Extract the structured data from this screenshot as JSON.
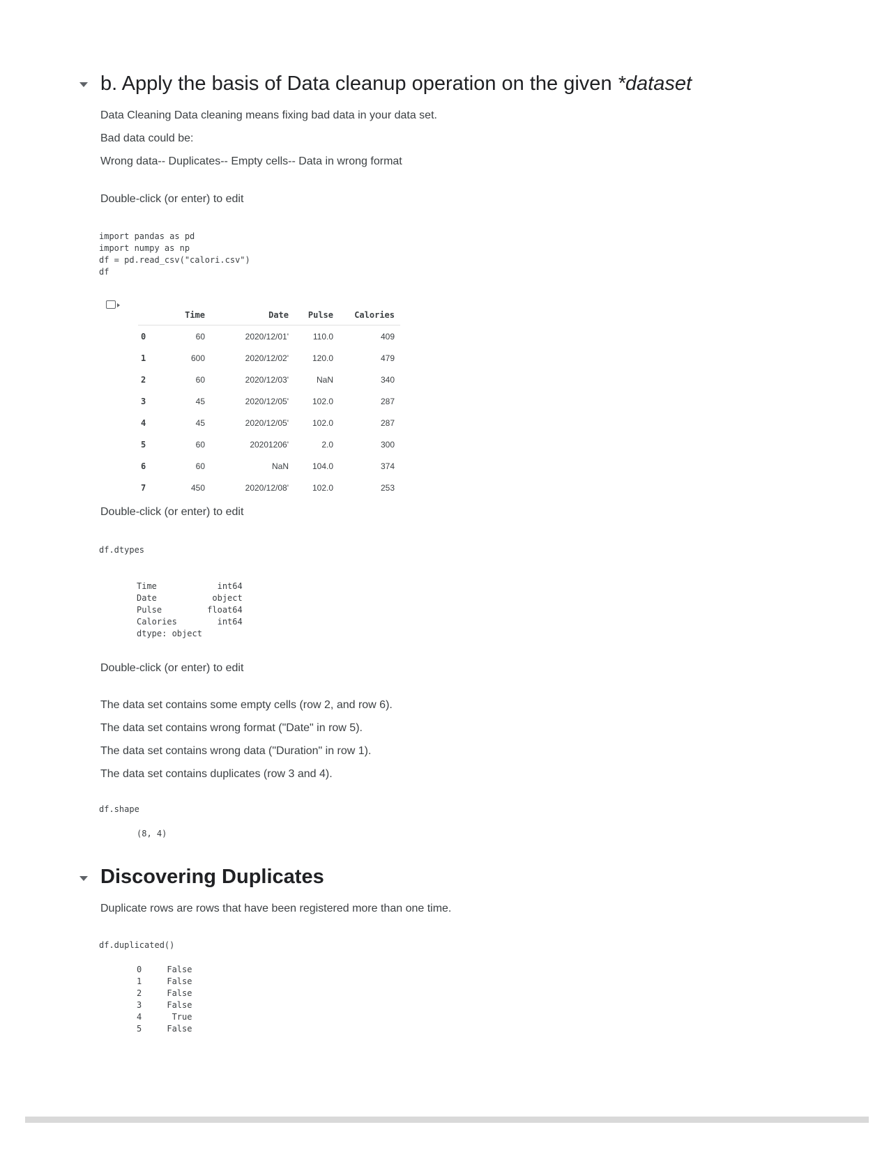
{
  "section1": {
    "heading_prefix": "b. Apply the basis of Data cleanup operation on the given ",
    "heading_italic": "*dataset",
    "para1": "Data Cleaning Data cleaning means fixing bad data in your data set.",
    "para2": "Bad data could be:",
    "para3": "Wrong data-- Duplicates-- Empty cells-- Data in wrong format",
    "edit_hint_1": "Double-click (or enter) to edit"
  },
  "cell1": {
    "code": "import pandas as pd\nimport numpy as np\ndf = pd.read_csv(\"calori.csv\")\ndf"
  },
  "table": {
    "headers": [
      "",
      "Time",
      "Date",
      "Pulse",
      "Calories"
    ],
    "rows": [
      [
        "0",
        "60",
        "2020/12/01'",
        "110.0",
        "409"
      ],
      [
        "1",
        "600",
        "2020/12/02'",
        "120.0",
        "479"
      ],
      [
        "2",
        "60",
        "2020/12/03'",
        "NaN",
        "340"
      ],
      [
        "3",
        "45",
        "2020/12/05'",
        "102.0",
        "287"
      ],
      [
        "4",
        "45",
        "2020/12/05'",
        "102.0",
        "287"
      ],
      [
        "5",
        "60",
        "20201206'",
        "2.0",
        "300"
      ],
      [
        "6",
        "60",
        "NaN",
        "104.0",
        "374"
      ],
      [
        "7",
        "450",
        "2020/12/08'",
        "102.0",
        "253"
      ]
    ]
  },
  "edit_hint_2": "Double-click (or enter) to edit",
  "cell2": {
    "code": "df.dtypes",
    "output": "Time            int64\nDate           object\nPulse         float64\nCalories        int64\ndtype: object"
  },
  "edit_hint_3": "Double-click (or enter) to edit",
  "notes": [
    "The data set contains some empty cells (row 2, and row 6).",
    "The data set contains wrong format (\"Date\" in row 5).",
    "The data set contains wrong data (\"Duration\" in row 1).",
    "The data set contains duplicates (row 3 and 4)."
  ],
  "cell3": {
    "code": "df.shape",
    "output": "(8, 4)"
  },
  "section2": {
    "heading": "Discovering Duplicates",
    "para": "Duplicate rows are rows that have been registered more than one time."
  },
  "cell4": {
    "code": "df.duplicated()",
    "output": "0     False\n1     False\n2     False\n3     False\n4      True\n5     False"
  }
}
